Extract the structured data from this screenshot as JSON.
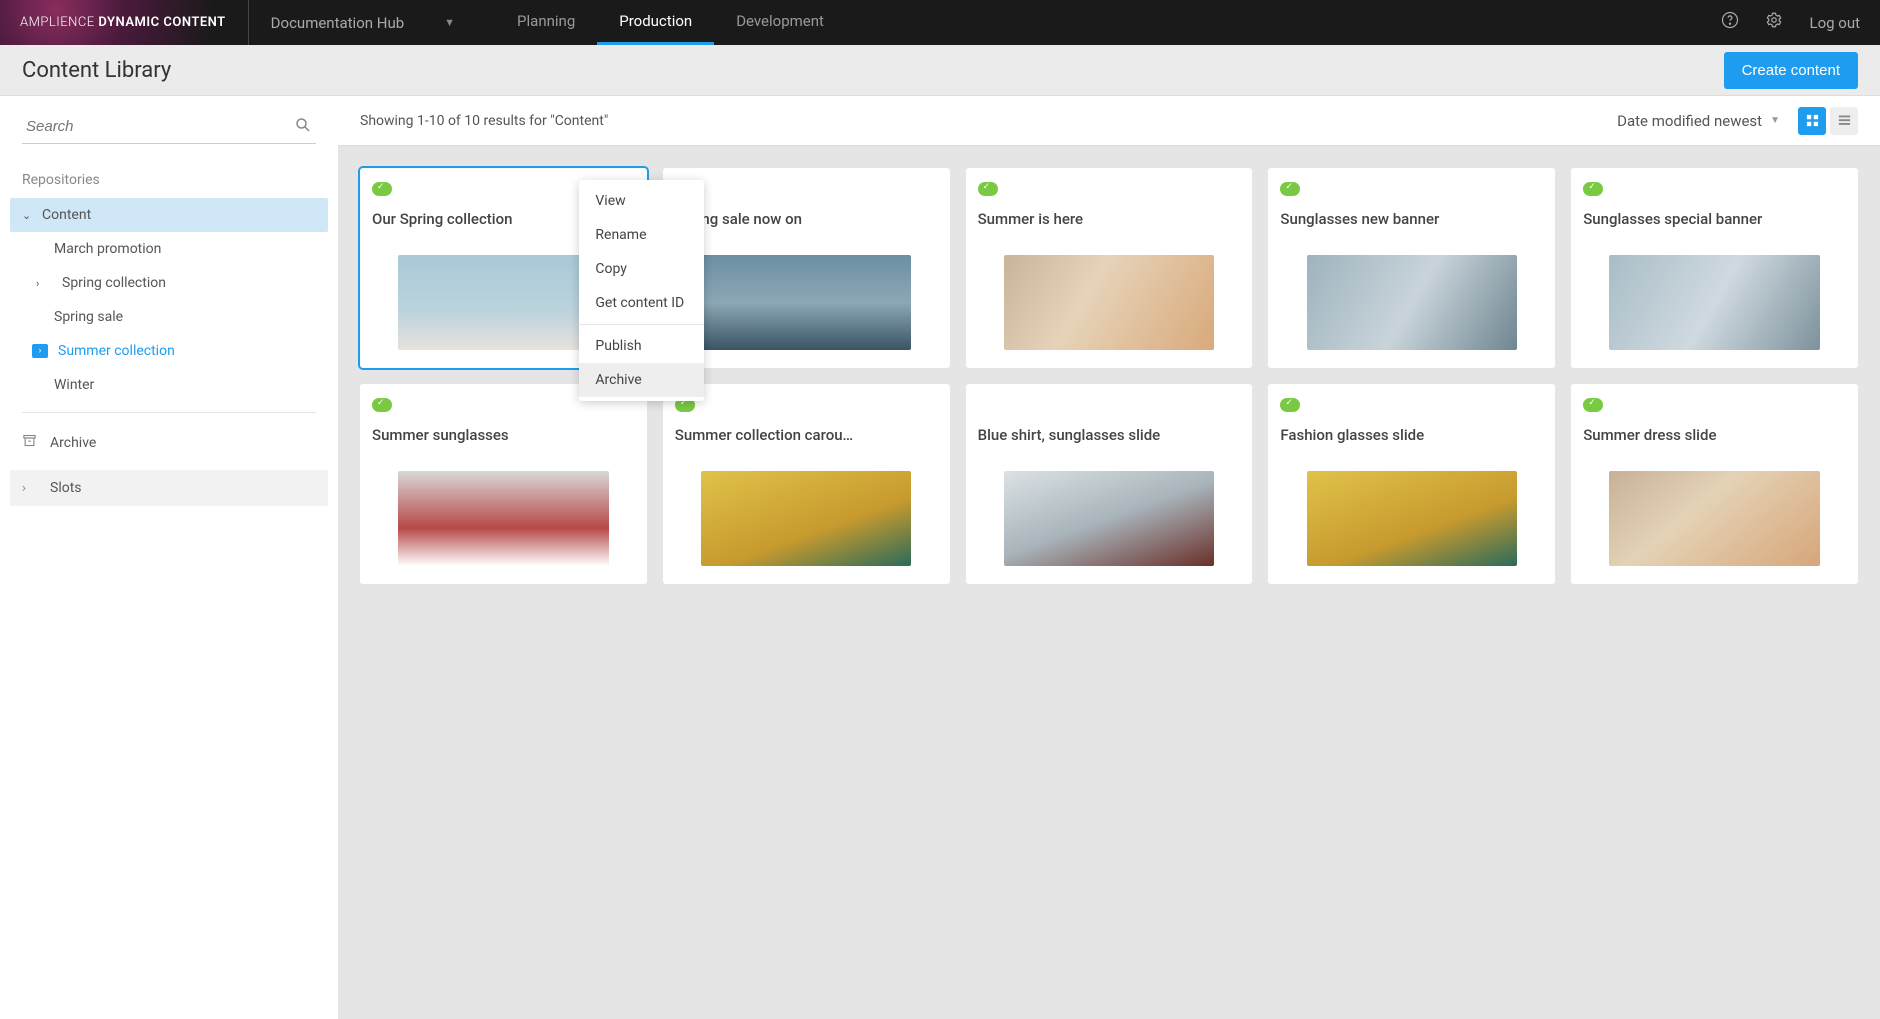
{
  "brand": {
    "prefix": "AMPLIENCE",
    "suffix": "DYNAMIC CONTENT"
  },
  "hub_dropdown": "Documentation Hub",
  "nav_tabs": [
    "Planning",
    "Production",
    "Development"
  ],
  "nav_active_index": 1,
  "logout": "Log out",
  "page_title": "Content Library",
  "create_button": "Create content",
  "search_placeholder": "Search",
  "sidebar": {
    "section_label": "Repositories",
    "root": "Content",
    "folders": [
      {
        "label": "March promotion",
        "expandable": false
      },
      {
        "label": "Spring collection",
        "expandable": true
      },
      {
        "label": "Spring sale",
        "expandable": false
      },
      {
        "label": "Summer collection",
        "expandable": false,
        "active": true
      },
      {
        "label": "Winter",
        "expandable": false
      }
    ],
    "archive": "Archive",
    "slots": "Slots"
  },
  "results_text": "Showing 1-10 of 10 results for \"Content\"",
  "sort_label": "Date modified newest",
  "context_menu": {
    "items_a": [
      "View",
      "Rename",
      "Copy",
      "Get content ID"
    ],
    "items_b": [
      "Publish",
      "Archive"
    ],
    "hover_index": 1
  },
  "cards": [
    {
      "title": "Our Spring collection",
      "thumb": "t1",
      "selected": true,
      "show_more": true,
      "status": true
    },
    {
      "title": "Spring sale now on",
      "thumb": "t2",
      "status": true
    },
    {
      "title": "Summer is here",
      "thumb": "t3",
      "status": true
    },
    {
      "title": "Sunglasses new banner",
      "thumb": "t4",
      "status": true
    },
    {
      "title": "Sunglasses special banner",
      "thumb": "t5",
      "status": true
    },
    {
      "title": "Summer sunglasses",
      "thumb": "t6",
      "status": true
    },
    {
      "title": "Summer collection carou…",
      "thumb": "t7",
      "status": true
    },
    {
      "title": "Blue shirt, sunglasses slide",
      "thumb": "t8"
    },
    {
      "title": "Fashion glasses slide",
      "thumb": "t9",
      "status": true
    },
    {
      "title": "Summer dress slide",
      "thumb": "t10",
      "status": true
    }
  ]
}
